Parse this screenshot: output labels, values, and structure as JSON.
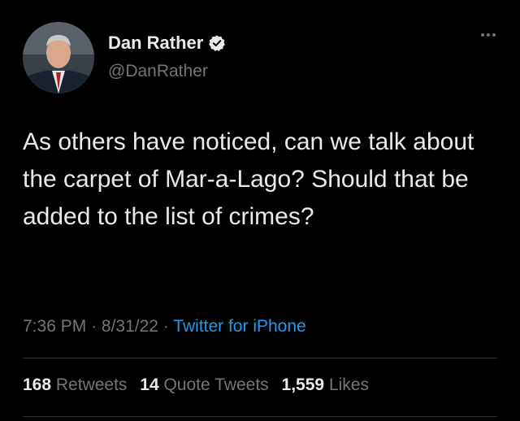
{
  "user": {
    "display_name": "Dan Rather",
    "handle": "@DanRather"
  },
  "tweet": {
    "text": "As others have noticed, can we talk about the carpet of Mar-a-Lago? Should that be added to the list of crimes?",
    "time": "7:36 PM",
    "separator": "·",
    "date": "8/31/22",
    "source": "Twitter for iPhone"
  },
  "stats": {
    "retweets_count": "168",
    "retweets_label": "Retweets",
    "quote_count": "14",
    "quote_label": "Quote Tweets",
    "likes_count": "1,559",
    "likes_label": "Likes"
  },
  "colors": {
    "background": "#000000",
    "text": "#e7e9ea",
    "muted": "#71767b",
    "accent": "#1d9bf0"
  },
  "icons": [
    "avatar",
    "verified-badge-icon",
    "more-options-icon"
  ]
}
